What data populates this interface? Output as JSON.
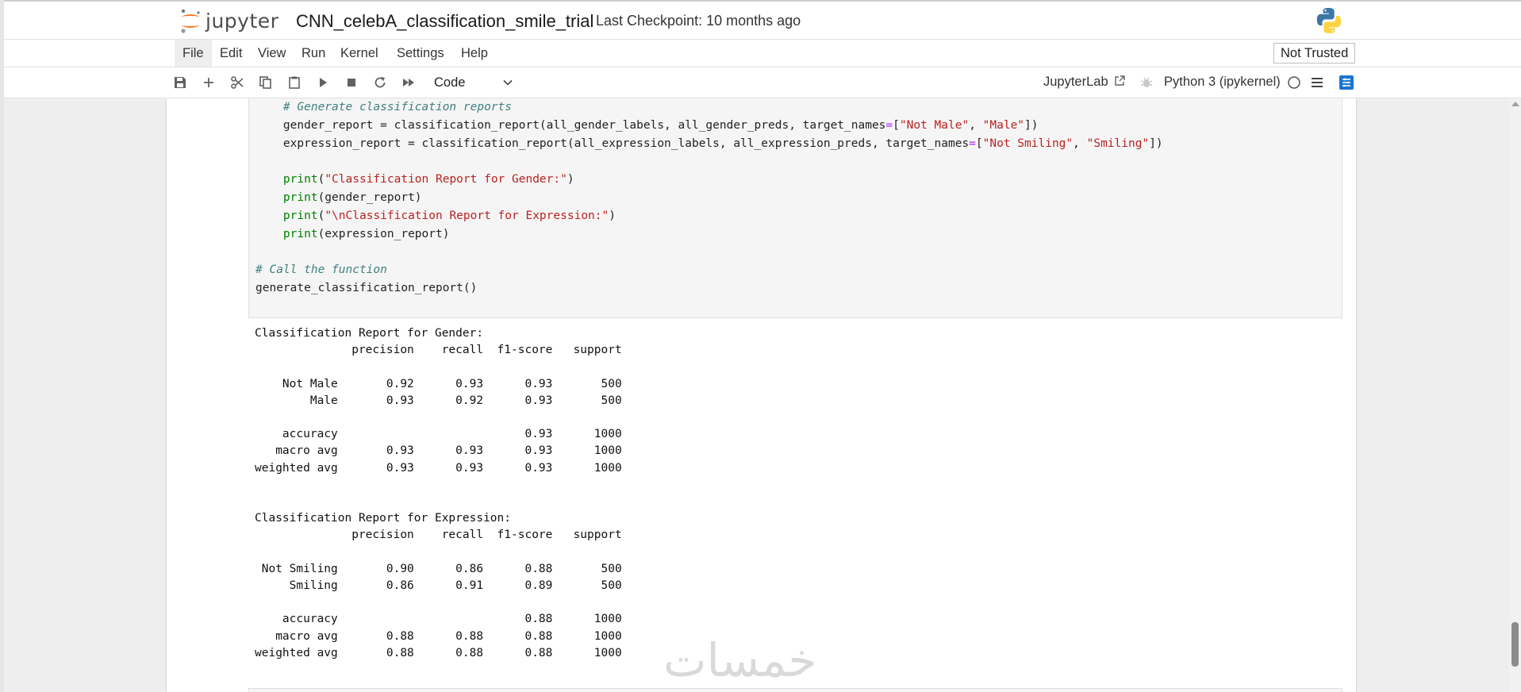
{
  "header": {
    "logo_text": "jupyter",
    "notebook_title": "CNN_celebA_classification_smile_trial",
    "checkpoint": "Last Checkpoint: 10 months ago"
  },
  "menu": {
    "items": [
      "File",
      "Edit",
      "View",
      "Run",
      "Kernel",
      "Settings",
      "Help"
    ],
    "trust_status": "Not Trusted"
  },
  "toolbar": {
    "cell_type": "Code",
    "jupyterlab_label": "JupyterLab",
    "kernel_name": "Python 3 (ipykernel)",
    "icons": [
      "save-icon",
      "add-cell-icon",
      "cut-icon",
      "copy-icon",
      "paste-icon",
      "run-icon",
      "stop-icon",
      "restart-icon",
      "fast-forward-icon",
      "chevron-down-icon",
      "external-link-icon",
      "debugger-icon",
      "kernel-status-icon",
      "menu-icon",
      "property-inspector-icon"
    ]
  },
  "code": {
    "line1": "    # Generate classification reports",
    "line2_a": "    gender_report = classification_report(all_gender_labels, all_gender_preds, target_names",
    "line2_op": "=",
    "line2_b": "[",
    "line2_s1": "\"Not Male\"",
    "line2_c": ", ",
    "line2_s2": "\"Male\"",
    "line2_d": "])",
    "line3_a": "    expression_report = classification_report(all_expression_labels, all_expression_preds, target_names",
    "line3_op": "=",
    "line3_b": "[",
    "line3_s1": "\"Not Smiling\"",
    "line3_c": ", ",
    "line3_s2": "\"Smiling\"",
    "line3_d": "])",
    "line5_kw": "print",
    "line5_s": "\"Classification Report for Gender:\"",
    "line6_kw": "print",
    "line6_a": "(gender_report)",
    "line7_kw": "print",
    "line7_s": "\"\\nClassification Report for Expression:\"",
    "line8_kw": "print",
    "line8_a": "(expression_report)",
    "line10": "# Call the function",
    "line11": "generate_classification_report()"
  },
  "output": {
    "text": "Classification Report for Gender:\n              precision    recall  f1-score   support\n\n    Not Male       0.92      0.93      0.93       500\n        Male       0.93      0.92      0.93       500\n\n    accuracy                           0.93      1000\n   macro avg       0.93      0.93      0.93      1000\nweighted avg       0.93      0.93      0.93      1000\n\n\nClassification Report for Expression:\n              precision    recall  f1-score   support\n\n Not Smiling       0.90      0.86      0.88       500\n     Smiling       0.86      0.91      0.89       500\n\n    accuracy                           0.88      1000\n   macro avg       0.88      0.88      0.88      1000\nweighted avg       0.88      0.88      0.88      1000"
  },
  "watermark": "خمسات"
}
